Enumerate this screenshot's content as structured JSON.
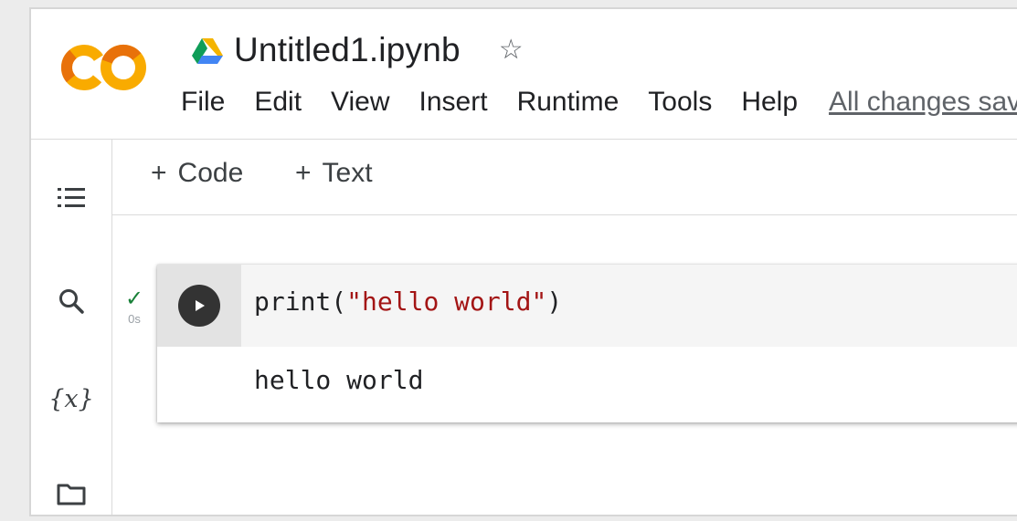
{
  "app": {
    "logo_text": "CO",
    "brand_colors": {
      "logo_orange": "#F9AB00",
      "logo_dark_orange": "#E8710A"
    }
  },
  "header": {
    "drive_icon": "google-drive-icon",
    "title": "Untitled1.ipynb",
    "star_icon": "star-outline-icon",
    "menu": [
      "File",
      "Edit",
      "View",
      "Insert",
      "Runtime",
      "Tools",
      "Help"
    ],
    "save_status": "All changes saved"
  },
  "sidebar": {
    "items": [
      {
        "icon": "table-of-contents-icon"
      },
      {
        "icon": "search-icon"
      },
      {
        "icon": "variables-icon",
        "label": "{x}"
      },
      {
        "icon": "folder-icon"
      }
    ]
  },
  "toolbar": {
    "add_code": "Code",
    "add_text": "Text",
    "plus": "+"
  },
  "cell": {
    "status_icon": "checkmark-icon",
    "status_check": "✓",
    "exec_time": "0s",
    "run_icon": "play-circle-icon",
    "code_fn": "print(",
    "code_str": "\"hello world\"",
    "code_close": ")",
    "output": "hello world",
    "colors": {
      "string": "#A31515",
      "run_button": "#333333",
      "success": "#188038"
    }
  }
}
